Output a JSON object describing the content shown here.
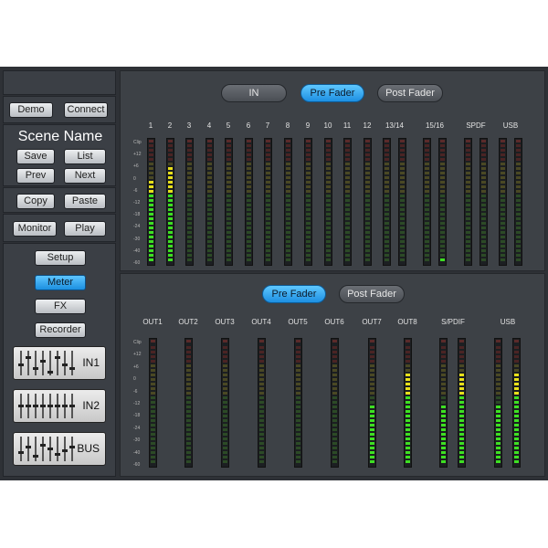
{
  "sidebar": {
    "demo_label": "Demo",
    "connect_label": "Connect",
    "scene_name": "Scene Name",
    "save_label": "Save",
    "list_label": "List",
    "prev_label": "Prev",
    "next_label": "Next",
    "copy_label": "Copy",
    "paste_label": "Paste",
    "monitor_label": "Monitor",
    "play_label": "Play",
    "setup_label": "Setup",
    "meter_label": "Meter",
    "fx_label": "FX",
    "recorder_label": "Recorder",
    "active_page": "Meter",
    "mixes": [
      "IN1",
      "IN2",
      "BUS"
    ]
  },
  "input_panel": {
    "tabs": [
      "IN",
      "Pre Fader",
      "Post Fader"
    ],
    "active_tab": "Pre Fader",
    "channels": [
      {
        "label": "1",
        "levels": [
          0.7
        ]
      },
      {
        "label": "2",
        "levels": [
          0.8
        ]
      },
      {
        "label": "3",
        "levels": [
          0
        ]
      },
      {
        "label": "4",
        "levels": [
          0
        ]
      },
      {
        "label": "5",
        "levels": [
          0
        ]
      },
      {
        "label": "6",
        "levels": [
          0
        ]
      },
      {
        "label": "7",
        "levels": [
          0
        ]
      },
      {
        "label": "8",
        "levels": [
          0
        ]
      },
      {
        "label": "9",
        "levels": [
          0
        ]
      },
      {
        "label": "10",
        "levels": [
          0
        ]
      },
      {
        "label": "11",
        "levels": [
          0
        ]
      },
      {
        "label": "12",
        "levels": [
          0
        ]
      },
      {
        "label": "13/14",
        "levels": [
          0,
          0
        ]
      },
      {
        "label": "15/16",
        "levels": [
          0,
          0.03
        ]
      },
      {
        "label": "SPDF",
        "levels": [
          0,
          0
        ]
      },
      {
        "label": "USB",
        "levels": [
          0,
          0
        ]
      }
    ]
  },
  "output_panel": {
    "tabs": [
      "Pre Fader",
      "Post Fader"
    ],
    "active_tab": "Pre Fader",
    "channels": [
      {
        "label": "OUT1",
        "levels": [
          0
        ]
      },
      {
        "label": "OUT2",
        "levels": [
          0
        ]
      },
      {
        "label": "OUT3",
        "levels": [
          0
        ]
      },
      {
        "label": "OUT4",
        "levels": [
          0
        ]
      },
      {
        "label": "OUT5",
        "levels": [
          0
        ]
      },
      {
        "label": "OUT6",
        "levels": [
          0
        ]
      },
      {
        "label": "OUT7",
        "levels": [
          0.5
        ]
      },
      {
        "label": "OUT8",
        "levels": [
          0.78
        ]
      },
      {
        "label": "S/PDIF",
        "levels": [
          0.5,
          0.78
        ]
      },
      {
        "label": "USB",
        "levels": [
          0.5,
          0.78
        ]
      }
    ]
  },
  "scale_labels": [
    "Clip",
    "+12",
    "+6",
    "0",
    "-6",
    "-12",
    "-18",
    "-24",
    "-30",
    "-40",
    "-60"
  ],
  "colors": {
    "background": "#2e3136",
    "panel": "#3d4146",
    "accent": "#1d8fe2",
    "meter_green": "#3ee022",
    "meter_yellow": "#e8e01a",
    "meter_red": "#e02020",
    "meter_off_green": "#2c4a26",
    "meter_off_yellow": "#4a4824",
    "meter_off_red": "#4a2424"
  }
}
